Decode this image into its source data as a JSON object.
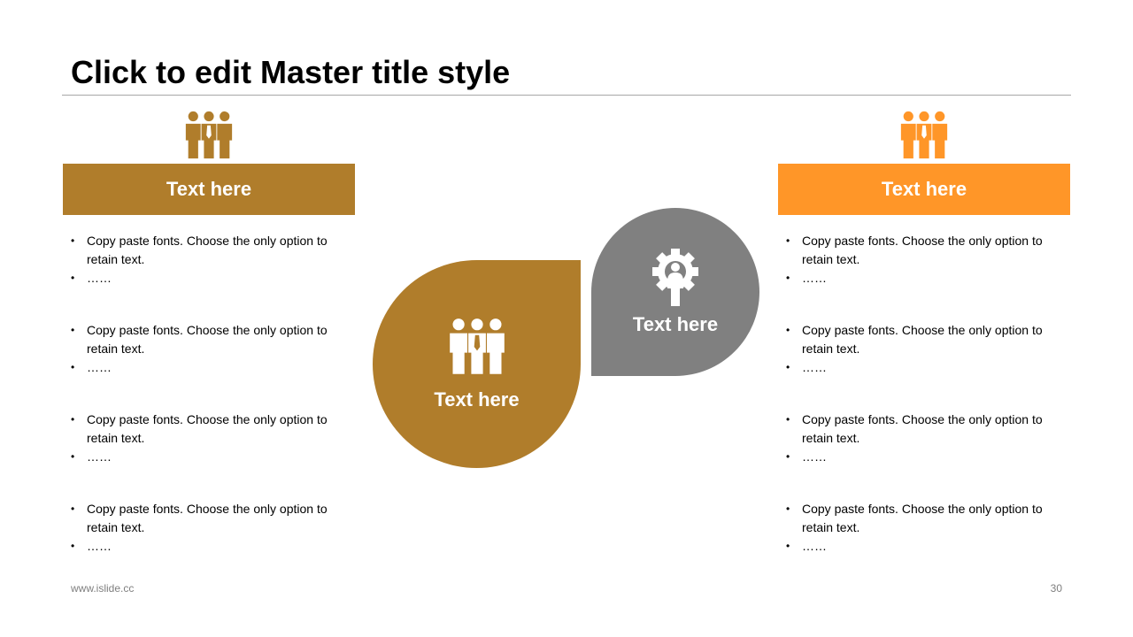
{
  "slide": {
    "title": "Click to edit Master title style",
    "footer_url": "www.islide.cc",
    "page_number": "30"
  },
  "colors": {
    "gold": "#b07d2b",
    "orange": "#ff9628",
    "gray": "#808080"
  },
  "left_panel": {
    "icon": "people-icon",
    "header": "Text here",
    "groups": [
      {
        "text": "Copy paste fonts. Choose the only option to retain text.",
        "more": "……"
      },
      {
        "text": "Copy paste fonts. Choose the only option to retain text.",
        "more": "……"
      },
      {
        "text": "Copy paste fonts. Choose the only option to retain text.",
        "more": "……"
      },
      {
        "text": "Copy paste fonts. Choose the only option to retain text.",
        "more": "……"
      }
    ]
  },
  "right_panel": {
    "icon": "people-icon",
    "header": "Text here",
    "groups": [
      {
        "text": "Copy paste fonts. Choose the only option to retain text.",
        "more": "……"
      },
      {
        "text": "Copy paste fonts. Choose the only option to retain text.",
        "more": "……"
      },
      {
        "text": "Copy paste fonts. Choose the only option to retain text.",
        "more": "……"
      },
      {
        "text": "Copy paste fonts. Choose the only option to retain text.",
        "more": "……"
      }
    ]
  },
  "center": {
    "gold_petal": {
      "icon": "people-icon",
      "label": "Text here"
    },
    "gray_petal": {
      "icon": "gear-person-icon",
      "label": "Text here"
    }
  }
}
